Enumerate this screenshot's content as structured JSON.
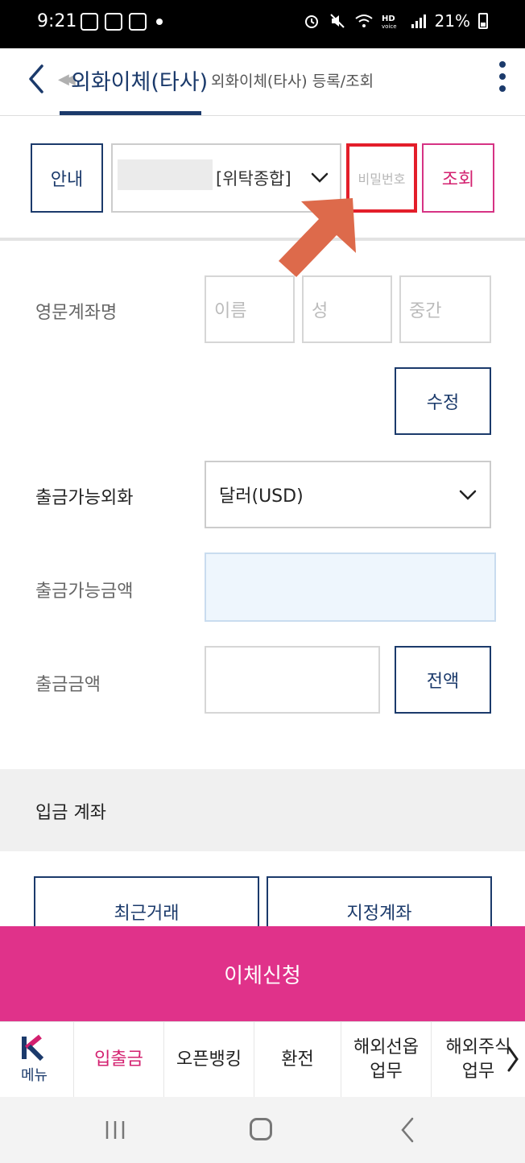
{
  "status_bar": {
    "time": "9:21",
    "battery": "21%",
    "icons": [
      "notification-2o-icon",
      "gallery-icon",
      "v-app-icon",
      "alarm-icon",
      "mute-icon",
      "wifi-icon",
      "hd-voice-icon",
      "signal-icon"
    ]
  },
  "header": {
    "active_tab": "외화이체(타사)",
    "sub_tab": "외화이체(타사) 등록/조회"
  },
  "account": {
    "info_button": "안내",
    "account_type": "[위탁종합]",
    "password_placeholder": "비밀번호",
    "query_button": "조회"
  },
  "form": {
    "english_name_label": "영문계좌명",
    "first_name_placeholder": "이름",
    "last_name_placeholder": "성",
    "middle_name_placeholder": "중간",
    "edit_button": "수정",
    "currency_label": "출금가능외화",
    "currency_value": "달러(USD)",
    "available_amount_label": "출금가능금액",
    "withdraw_amount_label": "출금금액",
    "full_amount_button": "전액"
  },
  "deposit": {
    "section_title": "입금 계좌",
    "recent_button": "최근거래",
    "designated_button": "지정계좌"
  },
  "submit_button": "이체신청",
  "bottom_nav": {
    "menu_label": "메뉴",
    "items": [
      {
        "label": "입출금"
      },
      {
        "label": "오픈뱅킹"
      },
      {
        "label": "환전"
      },
      {
        "label": "해외선옵\n업무"
      },
      {
        "label": "해외주식\n업무"
      }
    ]
  },
  "colors": {
    "navy": "#1b3a6b",
    "pink": "#e0328a",
    "highlight_red": "#e31e2a",
    "arrow_orange": "#dd6a4b"
  }
}
